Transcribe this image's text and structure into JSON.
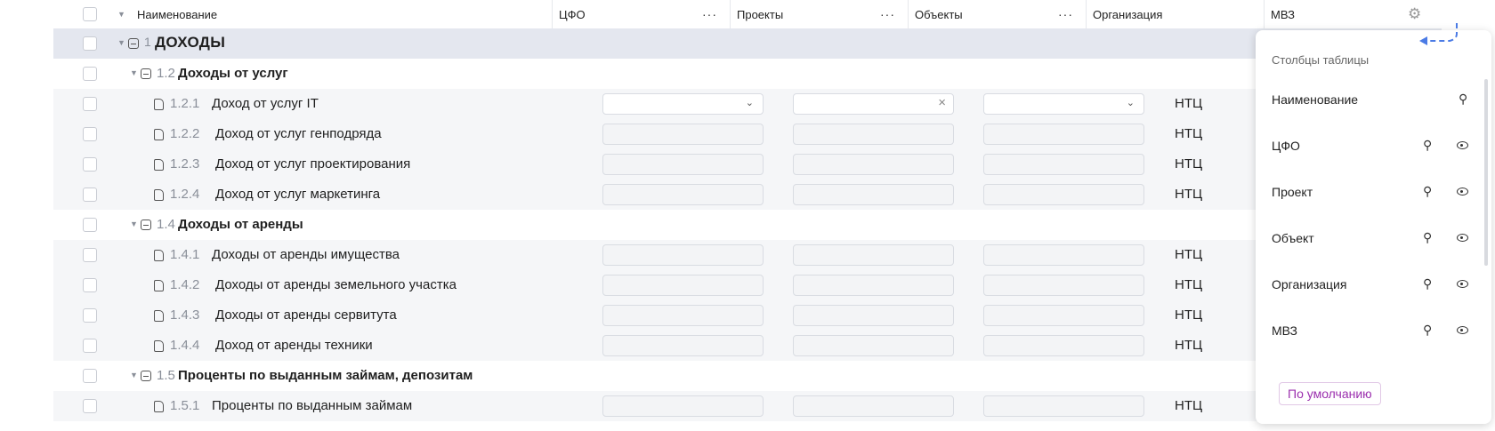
{
  "header": {
    "name_col": "Наименование",
    "cfo_col": "ЦФО",
    "projects_col": "Проекты",
    "objects_col": "Объекты",
    "org_col": "Организация",
    "mvz_col": "МВЗ",
    "more": "···"
  },
  "rows": [
    {
      "code": "1",
      "name": "ДОХОДЫ",
      "org": ""
    },
    {
      "code": "1.2",
      "name": "Доходы от услуг",
      "org": ""
    },
    {
      "code": "1.2.1",
      "name": "Доход от услуг IT",
      "org": "НТЦ"
    },
    {
      "code": "1.2.2",
      "name": "Доход от услуг генподряда",
      "org": "НТЦ"
    },
    {
      "code": "1.2.3",
      "name": "Доход от услуг проектирования",
      "org": "НТЦ"
    },
    {
      "code": "1.2.4",
      "name": "Доход от услуг маркетинга",
      "org": "НТЦ"
    },
    {
      "code": "1.4",
      "name": "Доходы от аренды",
      "org": ""
    },
    {
      "code": "1.4.1",
      "name": "Доходы от аренды имущества",
      "org": "НТЦ"
    },
    {
      "code": "1.4.2",
      "name": "Доходы от аренды земельного участка",
      "org": "НТЦ"
    },
    {
      "code": "1.4.3",
      "name": "Доходы от аренды сервитута",
      "org": "НТЦ"
    },
    {
      "code": "1.4.4",
      "name": "Доход от аренды техники",
      "org": "НТЦ"
    },
    {
      "code": "1.5",
      "name": "Проценты по выданным займам, депозитам",
      "org": ""
    },
    {
      "code": "1.5.1",
      "name": "Проценты по выданным займам",
      "org": "НТЦ"
    }
  ],
  "column_panel": {
    "title": "Столбцы таблицы",
    "items": [
      "Наименование",
      "ЦФО",
      "Проект",
      "Объект",
      "Организация",
      "МВЗ"
    ],
    "default_button": "По умолчанию"
  },
  "icons": {
    "settings": "gear-icon",
    "pin": "pin-icon",
    "eye": "eye-icon",
    "folder": "folder-minus-icon",
    "doc": "document-icon"
  }
}
